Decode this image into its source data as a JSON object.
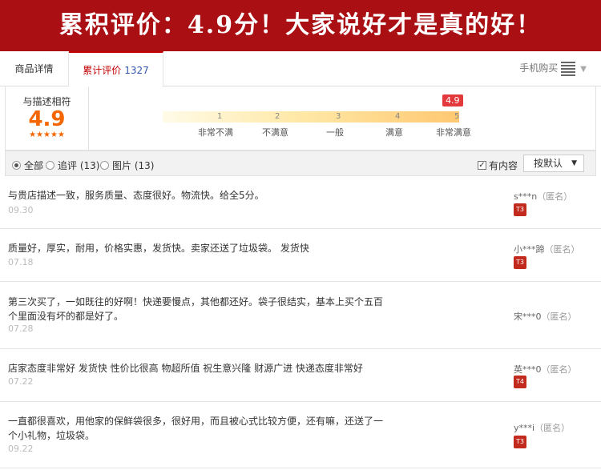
{
  "banner": {
    "text": "累积评价：4.9分！大家说好才是真的好！"
  },
  "tabs": {
    "detail": "商品详情",
    "reviews": "累计评价",
    "review_count": "1327",
    "mobile": "手机购买"
  },
  "summary": {
    "label": "与描述相符",
    "score": "4.9",
    "stars": "★★★★★",
    "badge": "4.9",
    "ticks": [
      "1",
      "2",
      "3",
      "4",
      "5"
    ],
    "tick_labels": [
      "非常不满",
      "不满意",
      "一般",
      "满意",
      "非常满意"
    ]
  },
  "filter": {
    "all": "全部",
    "followup": "追评 (13)",
    "images": "图片 (13)",
    "has_content": "有内容",
    "sort": "按默认"
  },
  "reviews": [
    {
      "text": "与贵店描述一致，服务质量、态度很好。物流快。给全5分。",
      "date": "09.30",
      "user": "s***n",
      "anon": "（匿名）",
      "level": "T3"
    },
    {
      "text": "质量好，厚实，耐用，价格实惠，发货快。卖家还送了垃圾袋。 发货快",
      "date": "07.18",
      "user": "小***蹄",
      "anon": "（匿名）",
      "level": "T3"
    },
    {
      "text": "第三次买了，一如既往的好啊！快递要慢点，其他都还好。袋子很结实，基本上买个五百个里面没有坏的都是好了。",
      "date": "07.28",
      "user": "宋***0",
      "anon": "（匿名）",
      "level": ""
    },
    {
      "text": "店家态度非常好 发货快 性价比很高 物超所值 祝生意兴隆 财源广进 快递态度非常好",
      "date": "07.22",
      "user": "英***0",
      "anon": "（匿名）",
      "level": "T4"
    },
    {
      "text": "一直都很喜欢，用他家的保鲜袋很多，很好用，而且被心式比较方便，还有嘛，还送了一个小礼物，垃圾袋。",
      "date": "09.22",
      "user": "y***i",
      "anon": "（匿名）",
      "level": "T3"
    }
  ],
  "colors": {
    "banner": "#a90f13",
    "accent": "#c40000",
    "score": "#f56600"
  }
}
